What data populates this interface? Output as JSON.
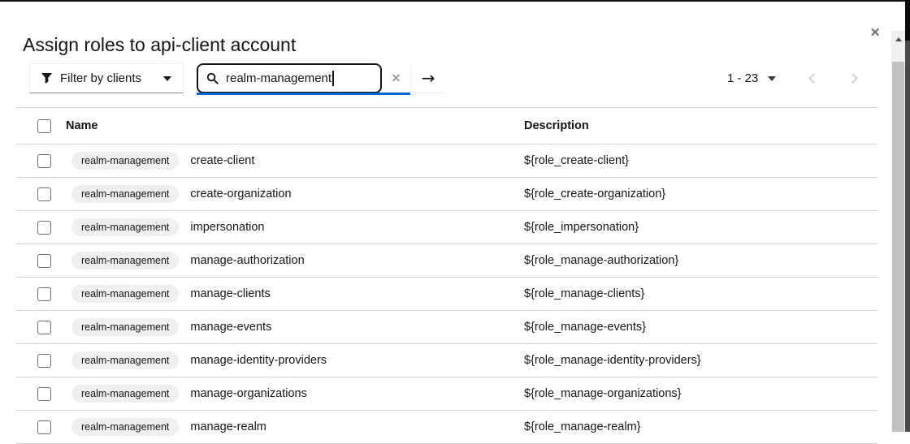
{
  "modal": {
    "title": "Assign roles to api-client account",
    "close_icon_glyph": "✕"
  },
  "toolbar": {
    "filter_dropdown": {
      "label": "Filter by clients",
      "icon": "filter-funnel-icon"
    },
    "search": {
      "value": "realm-management",
      "icon": "search-icon",
      "clear_glyph": "✕",
      "submit_glyph": "→",
      "focused": true
    },
    "pagination": {
      "range": "1 - 23",
      "prev_enabled": false,
      "next_enabled": false
    }
  },
  "table": {
    "columns": [
      "Name",
      "Description"
    ],
    "select_all_checked": false,
    "rows": [
      {
        "client": "realm-management",
        "name": "create-client",
        "description": "${role_create-client}",
        "checked": false
      },
      {
        "client": "realm-management",
        "name": "create-organization",
        "description": "${role_create-organization}",
        "checked": false
      },
      {
        "client": "realm-management",
        "name": "impersonation",
        "description": "${role_impersonation}",
        "checked": false
      },
      {
        "client": "realm-management",
        "name": "manage-authorization",
        "description": "${role_manage-authorization}",
        "checked": false
      },
      {
        "client": "realm-management",
        "name": "manage-clients",
        "description": "${role_manage-clients}",
        "checked": false
      },
      {
        "client": "realm-management",
        "name": "manage-events",
        "description": "${role_manage-events}",
        "checked": false
      },
      {
        "client": "realm-management",
        "name": "manage-identity-providers",
        "description": "${role_manage-identity-providers}",
        "checked": false
      },
      {
        "client": "realm-management",
        "name": "manage-organizations",
        "description": "${role_manage-organizations}",
        "checked": false
      },
      {
        "client": "realm-management",
        "name": "manage-realm",
        "description": "${role_manage-realm}",
        "checked": false
      }
    ]
  },
  "colors": {
    "focus_accent": "#0066cc",
    "text": "#151515",
    "muted_icon": "#6a6e73",
    "disabled_icon": "#d2d2d2",
    "badge_bg": "#f0f0f0",
    "row_border": "#d2d2d2"
  }
}
